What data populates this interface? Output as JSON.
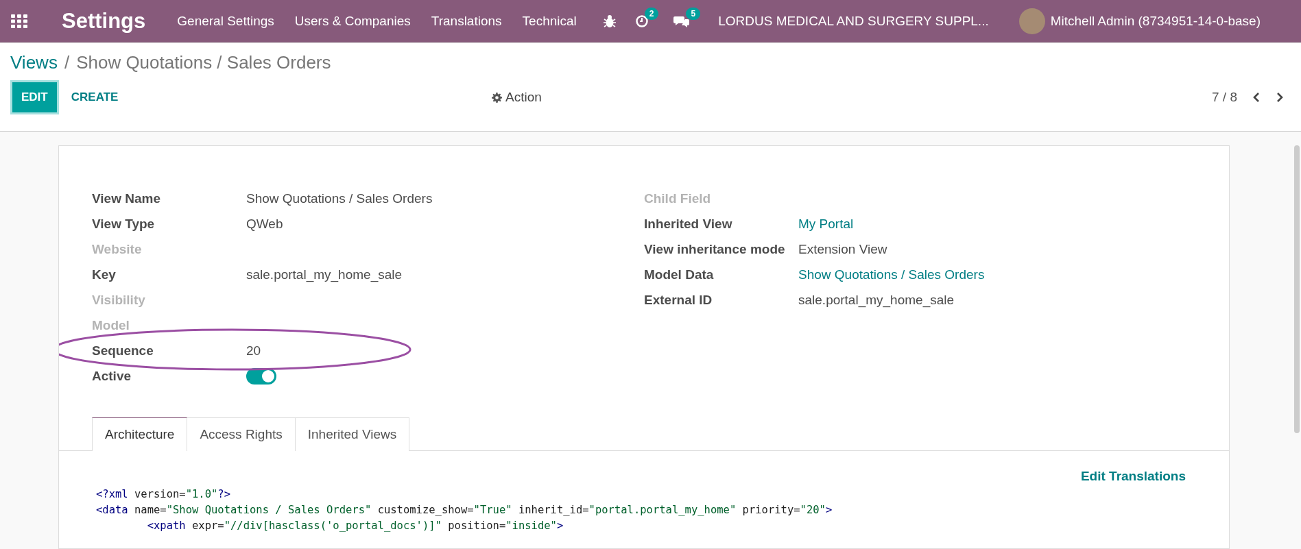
{
  "navbar": {
    "app_title": "Settings",
    "menu": [
      "General Settings",
      "Users & Companies",
      "Translations",
      "Technical"
    ],
    "activity_count": "2",
    "message_count": "5",
    "company": "LORDUS MEDICAL AND SURGERY SUPPL...",
    "user": "Mitchell Admin (8734951-14-0-base)"
  },
  "breadcrumb": {
    "parent": "Views",
    "separator": "/",
    "current": "Show Quotations / Sales Orders"
  },
  "control_panel": {
    "buttons": [
      "EDIT",
      "CREATE"
    ],
    "action": "Action",
    "pager": "7 / 8"
  },
  "form": {
    "left_fields": [
      {
        "label": "View Name",
        "value": "Show Quotations / Sales Orders",
        "muted": false,
        "kind": "text"
      },
      {
        "label": "View Type",
        "value": "QWeb",
        "muted": false,
        "kind": "text"
      },
      {
        "label": "Website",
        "muted": true,
        "kind": "text"
      },
      {
        "label": "Key",
        "value": "sale.portal_my_home_sale",
        "muted": false,
        "kind": "text"
      },
      {
        "label": "Visibility",
        "muted": true,
        "kind": "text"
      },
      {
        "label": "Model",
        "muted": true,
        "kind": "text"
      },
      {
        "label": "Sequence",
        "value": "20",
        "muted": false,
        "kind": "text"
      },
      {
        "label": "Active",
        "muted": false,
        "kind": "toggle",
        "on": true
      }
    ],
    "right_fields": [
      {
        "label": "Child Field",
        "muted": true
      },
      {
        "label": "Inherited View",
        "value": "My Portal",
        "muted": false,
        "link": true
      },
      {
        "label": "View inheritance mode",
        "value": "Extension View",
        "muted": false,
        "link": false
      },
      {
        "label": "Model Data",
        "value": "Show Quotations / Sales Orders",
        "muted": false,
        "link": true
      },
      {
        "label": "External ID",
        "value": "sale.portal_my_home_sale",
        "muted": false,
        "link": false
      }
    ],
    "tabs": [
      {
        "label": "Architecture",
        "selected": true
      },
      {
        "label": "Access Rights",
        "selected": false
      },
      {
        "label": "Inherited Views",
        "selected": false
      }
    ],
    "edit_translations": "Edit Translations",
    "code_lines": [
      "<?xml version=\"1.0\"?>",
      "<data name=\"Show Quotations / Sales Orders\" customize_show=\"True\" inherit_id=\"portal.portal_my_home\" priority=\"20\">",
      "        <xpath expr=\"//div[hasclass('o_portal_docs')]\" position=\"inside\">"
    ]
  }
}
